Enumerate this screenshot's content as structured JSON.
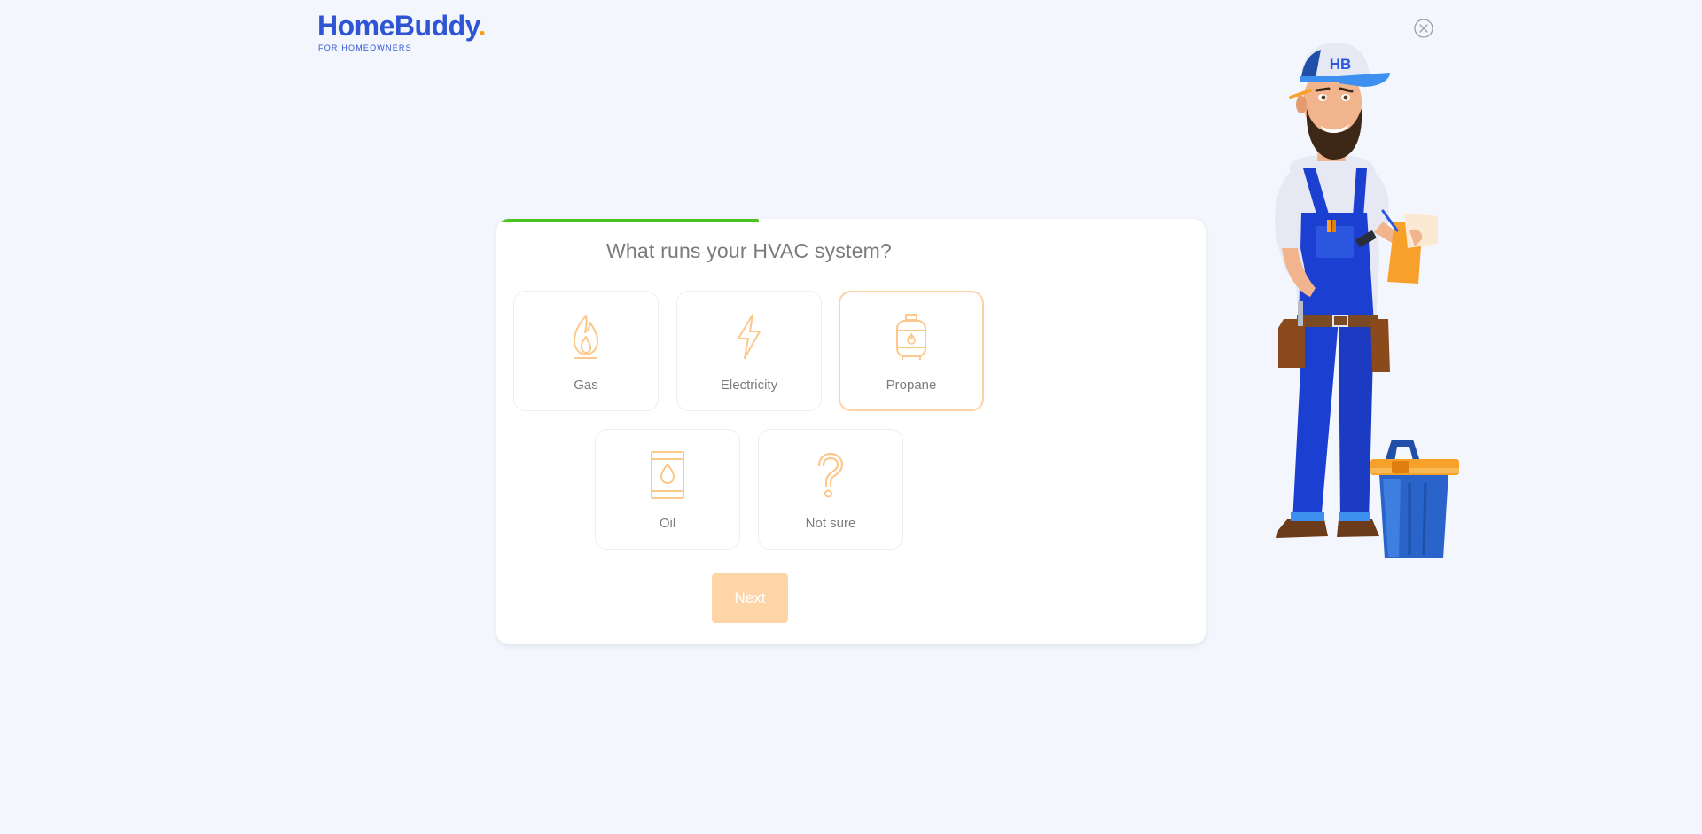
{
  "brand": {
    "name": "HomeBuddy",
    "dot": ".",
    "tagline": "FOR HOMEOWNERS",
    "primary_color": "#2f55d4",
    "accent_color": "#f59c1a"
  },
  "close": {
    "icon": "close-circle-icon"
  },
  "progress": {
    "fraction": 0.37,
    "color": "#4ac41f"
  },
  "question": {
    "title": "What runs your HVAC system?"
  },
  "options": [
    {
      "label": "Gas",
      "icon": "flame-icon",
      "selected": false
    },
    {
      "label": "Electricity",
      "icon": "lightning-icon",
      "selected": false
    },
    {
      "label": "Propane",
      "icon": "propane-tank-icon",
      "selected": true
    },
    {
      "label": "Oil",
      "icon": "oil-barrel-icon",
      "selected": false
    },
    {
      "label": "Not sure",
      "icon": "question-mark-icon",
      "selected": false
    }
  ],
  "next_button": {
    "label": "Next",
    "disabled": true,
    "color": "#fdd5a7"
  },
  "mascot": {
    "cap_text": "HB"
  }
}
